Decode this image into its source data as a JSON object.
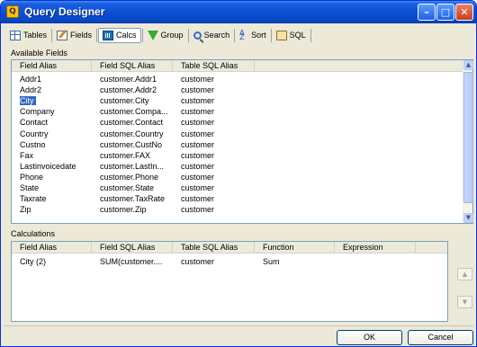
{
  "window": {
    "title": "Query Designer",
    "icon": "Q",
    "buttons": {
      "minimize": "–",
      "maximize": "□",
      "close": "✕"
    }
  },
  "toolbar": {
    "tables": "Tables",
    "fields": "Fields",
    "calcs": "Calcs",
    "group": "Group",
    "search": "Search",
    "sort": "Sort",
    "sql": "SQL",
    "active": "calcs"
  },
  "available_fields": {
    "label": "Available Fields",
    "columns": [
      "Field Alias",
      "Field SQL Alias",
      "Table SQL Alias"
    ],
    "rows": [
      [
        "Addr1",
        "customer.Addr1",
        "customer"
      ],
      [
        "Addr2",
        "customer.Addr2",
        "customer"
      ],
      [
        "City",
        "customer.City",
        "customer"
      ],
      [
        "Company",
        "customer.Compa...",
        "customer"
      ],
      [
        "Contact",
        "customer.Contact",
        "customer"
      ],
      [
        "Country",
        "customer.Country",
        "customer"
      ],
      [
        "Custno",
        "customer.CustNo",
        "customer"
      ],
      [
        "Fax",
        "customer.FAX",
        "customer"
      ],
      [
        "Lastinvoicedate",
        "customer.LastIn...",
        "customer"
      ],
      [
        "Phone",
        "customer.Phone",
        "customer"
      ],
      [
        "State",
        "customer.State",
        "customer"
      ],
      [
        "Taxrate",
        "customer.TaxRate",
        "customer"
      ],
      [
        "Zip",
        "customer.Zip",
        "customer"
      ]
    ],
    "selected_row": "City"
  },
  "calculations": {
    "label": "Calculations",
    "columns": [
      "Field Alias",
      "Field SQL Alias",
      "Table SQL Alias",
      "Function",
      "Expression"
    ],
    "rows": [
      [
        "City (2)",
        "SUM(customer....",
        "customer",
        "Sum",
        ""
      ]
    ]
  },
  "side_buttons": {
    "up": "▲",
    "down": "▼"
  },
  "dialog": {
    "ok": "OK",
    "cancel": "Cancel"
  },
  "scrollbar": {
    "up": "▲",
    "down": "▼"
  },
  "colors": {
    "titlebar": "#0a4fd4",
    "selection": "#316ac5",
    "face": "#ece9d8"
  }
}
